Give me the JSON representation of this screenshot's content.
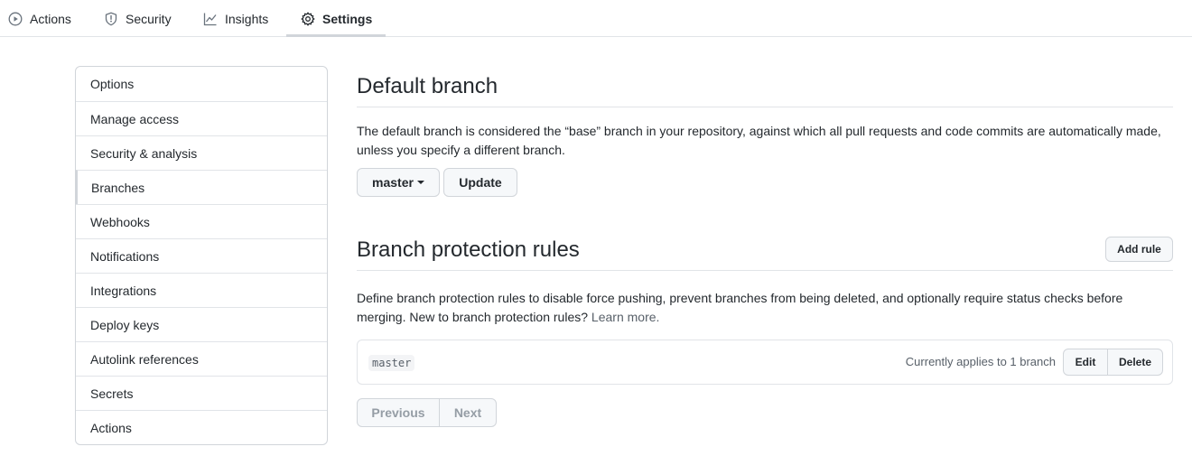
{
  "tabs": [
    {
      "label": "Actions",
      "icon": "play-circle-icon"
    },
    {
      "label": "Security",
      "icon": "shield-icon"
    },
    {
      "label": "Insights",
      "icon": "graph-icon"
    },
    {
      "label": "Settings",
      "icon": "gear-icon"
    }
  ],
  "sidebar": {
    "items": [
      {
        "label": "Options"
      },
      {
        "label": "Manage access"
      },
      {
        "label": "Security & analysis"
      },
      {
        "label": "Branches"
      },
      {
        "label": "Webhooks"
      },
      {
        "label": "Notifications"
      },
      {
        "label": "Integrations"
      },
      {
        "label": "Deploy keys"
      },
      {
        "label": "Autolink references"
      },
      {
        "label": "Secrets"
      },
      {
        "label": "Actions"
      }
    ]
  },
  "default_branch": {
    "title": "Default branch",
    "description": "The default branch is considered the “base” branch in your repository, against which all pull requests and code commits are automatically made, unless you specify a different branch.",
    "branch_select": "master",
    "update_label": "Update"
  },
  "protection": {
    "title": "Branch protection rules",
    "add_rule_label": "Add rule",
    "description": "Define branch protection rules to disable force pushing, prevent branches from being deleted, and optionally require status checks before merging. New to branch protection rules?",
    "learn_more": "Learn more.",
    "rules": [
      {
        "pattern": "master",
        "applies": "Currently applies to 1 branch",
        "edit_label": "Edit",
        "delete_label": "Delete"
      }
    ],
    "pagination": {
      "previous": "Previous",
      "next": "Next"
    }
  },
  "colors": {
    "border": "#d1d5da",
    "text": "#24292e",
    "muted": "#586069",
    "disabled": "#959da5",
    "button_bg": "#f6f8fa"
  }
}
